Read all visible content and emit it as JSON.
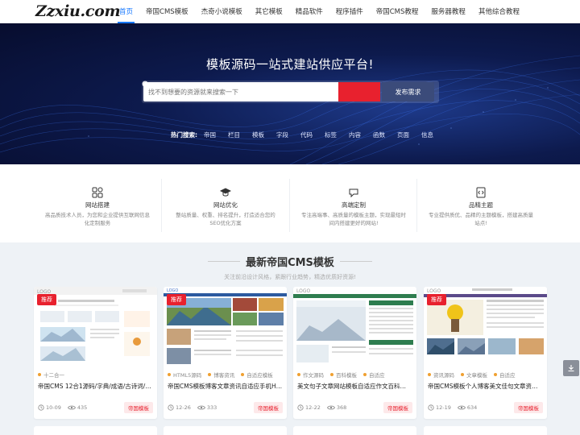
{
  "header": {
    "logo": "Zzxiu.com",
    "nav": [
      "首页",
      "帝国CMS模板",
      "杰奇小说模板",
      "其它模板",
      "精品软件",
      "程序插件",
      "帝国CMS教程",
      "服务器教程",
      "其他综合教程"
    ]
  },
  "hero": {
    "title": "模板源码一站式建站供应平台!",
    "search_placeholder": "找不到想要的资源就来搜索一下",
    "publish_label": "发布需求",
    "hot_label": "热门搜索:",
    "hot_items": [
      "帝国",
      "栏目",
      "模板",
      "字段",
      "代码",
      "标签",
      "内容",
      "函数",
      "页面",
      "信息"
    ]
  },
  "features": [
    {
      "icon": "grid-icon",
      "title": "网站搭建",
      "desc": "高品质技术人员，为您和企业提供互联网信息化定制服务"
    },
    {
      "icon": "graduation-cap-icon",
      "title": "网站优化",
      "desc": "整站质量、权重、排名提升，打造适合您的SEO优化方案"
    },
    {
      "icon": "chat-bubble-icon",
      "title": "高端定制",
      "desc": "专注高端事、高质量的模板主题，实现最短时间内搭建更好的网站!"
    },
    {
      "icon": "code-file-icon",
      "title": "品精主题",
      "desc": "专业提供质优、品精的主题模板，搭建高质量站点!"
    }
  ],
  "section": {
    "title": "最新帝国CMS模板",
    "subtitle": "关注前沿设计风格，紧跟行业趋势，精选优质好资源!"
  },
  "cards": [
    {
      "badge": "推荐",
      "tags": [
        "十二合一"
      ],
      "title": "帝国CMS 12合1源码/字典/成语/古诗词/…",
      "date": "10-09",
      "views": "435",
      "category": "帝国模板"
    },
    {
      "badge": "推荐",
      "tags": [
        "HTML5源码",
        "博客资讯",
        "自适应模板"
      ],
      "title": "帝国CMS模板博客文章资讯自适应手机H…",
      "date": "12-26",
      "views": "333",
      "category": "帝国模板"
    },
    {
      "badge": "",
      "tags": [
        "作文源码",
        "百科模板",
        "自适应"
      ],
      "title": "美文句子文章网站模板自适应作文百科…",
      "date": "12-22",
      "views": "368",
      "category": "帝国模板"
    },
    {
      "badge": "推荐",
      "tags": [
        "资讯源码",
        "文章模板",
        "自适应"
      ],
      "title": "帝国CMS模板个人博客美文佳句文章资…",
      "date": "12-19",
      "views": "634",
      "category": "帝国模板"
    }
  ],
  "thumb_text": {
    "logo": "LOGO"
  }
}
